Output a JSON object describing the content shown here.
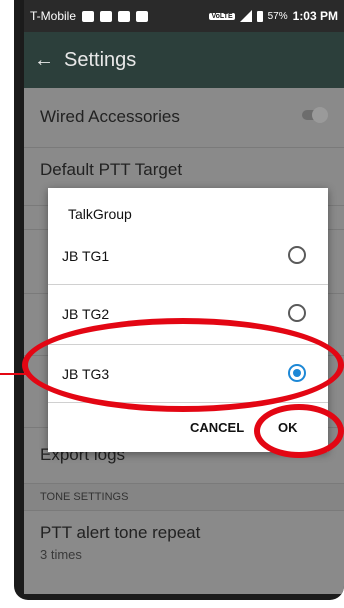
{
  "status_bar": {
    "carrier": "T-Mobile",
    "battery": "57%",
    "time": "1:03 PM",
    "network_badge": "VoLTE"
  },
  "app_bar": {
    "title": "Settings",
    "back_icon": "arrow-left-icon"
  },
  "settings": {
    "wired_accessories": "Wired Accessories",
    "default_ptt_target": "Default PTT Target",
    "export_logs": "Export logs",
    "tone_section": "TONE SETTINGS",
    "ptt_alert_title": "PTT alert tone repeat",
    "ptt_alert_value": "3 times"
  },
  "dialog": {
    "title": "TalkGroup",
    "options": [
      {
        "label": "JB TG1",
        "selected": false
      },
      {
        "label": "JB TG2",
        "selected": false
      },
      {
        "label": "JB TG3",
        "selected": true
      }
    ],
    "cancel_label": "CANCEL",
    "ok_label": "OK"
  },
  "colors": {
    "accent": "#1d88d6",
    "annotation": "#e30613",
    "app_bar": "#2c3f3b"
  }
}
